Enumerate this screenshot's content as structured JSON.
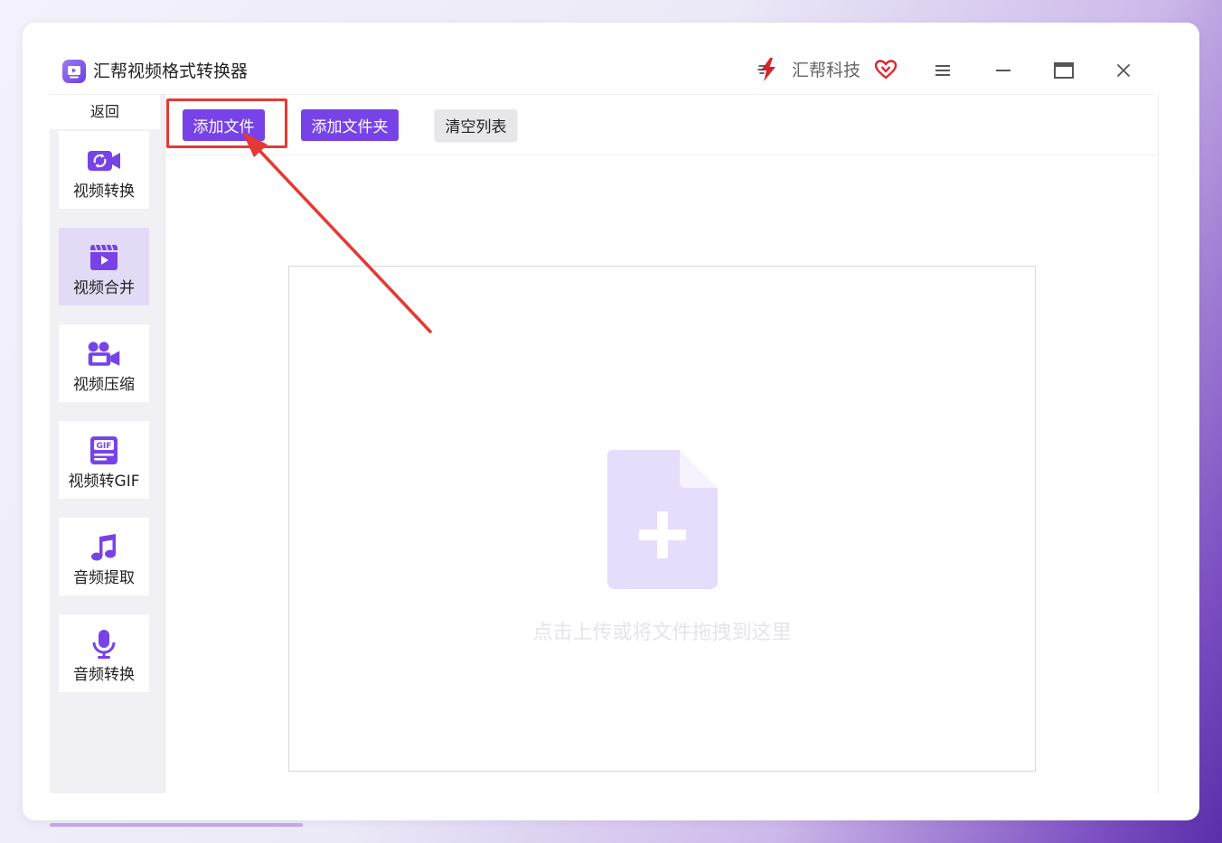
{
  "app": {
    "title": "汇帮视频格式转换器",
    "brand_name": "汇帮科技"
  },
  "colors": {
    "accent": "#7743e8",
    "sidebar_bg": "#f1f0f4",
    "active_item_bg": "#e3dbf6",
    "annotation_red": "#e53935"
  },
  "window_controls": {
    "menu": "menu-icon",
    "minimize": "minimize-icon",
    "maximize": "maximize-icon",
    "close": "close-icon"
  },
  "sidebar": {
    "back_label": "返回",
    "items": [
      {
        "label": "视频转换",
        "icon": "video-convert-icon",
        "active": false
      },
      {
        "label": "视频合并",
        "icon": "video-merge-icon",
        "active": true
      },
      {
        "label": "视频压缩",
        "icon": "video-compress-icon",
        "active": false
      },
      {
        "label": "视频转GIF",
        "icon": "gif-icon",
        "active": false
      },
      {
        "label": "音频提取",
        "icon": "music-note-icon",
        "active": false
      },
      {
        "label": "音频转换",
        "icon": "microphone-icon",
        "active": false
      }
    ]
  },
  "toolbar": {
    "add_file_label": "添加文件",
    "add_folder_label": "添加文件夹",
    "clear_list_label": "清空列表"
  },
  "drop_zone": {
    "hint_text": "点击上传或将文件拖拽到这里",
    "icon": "file-add-icon"
  }
}
